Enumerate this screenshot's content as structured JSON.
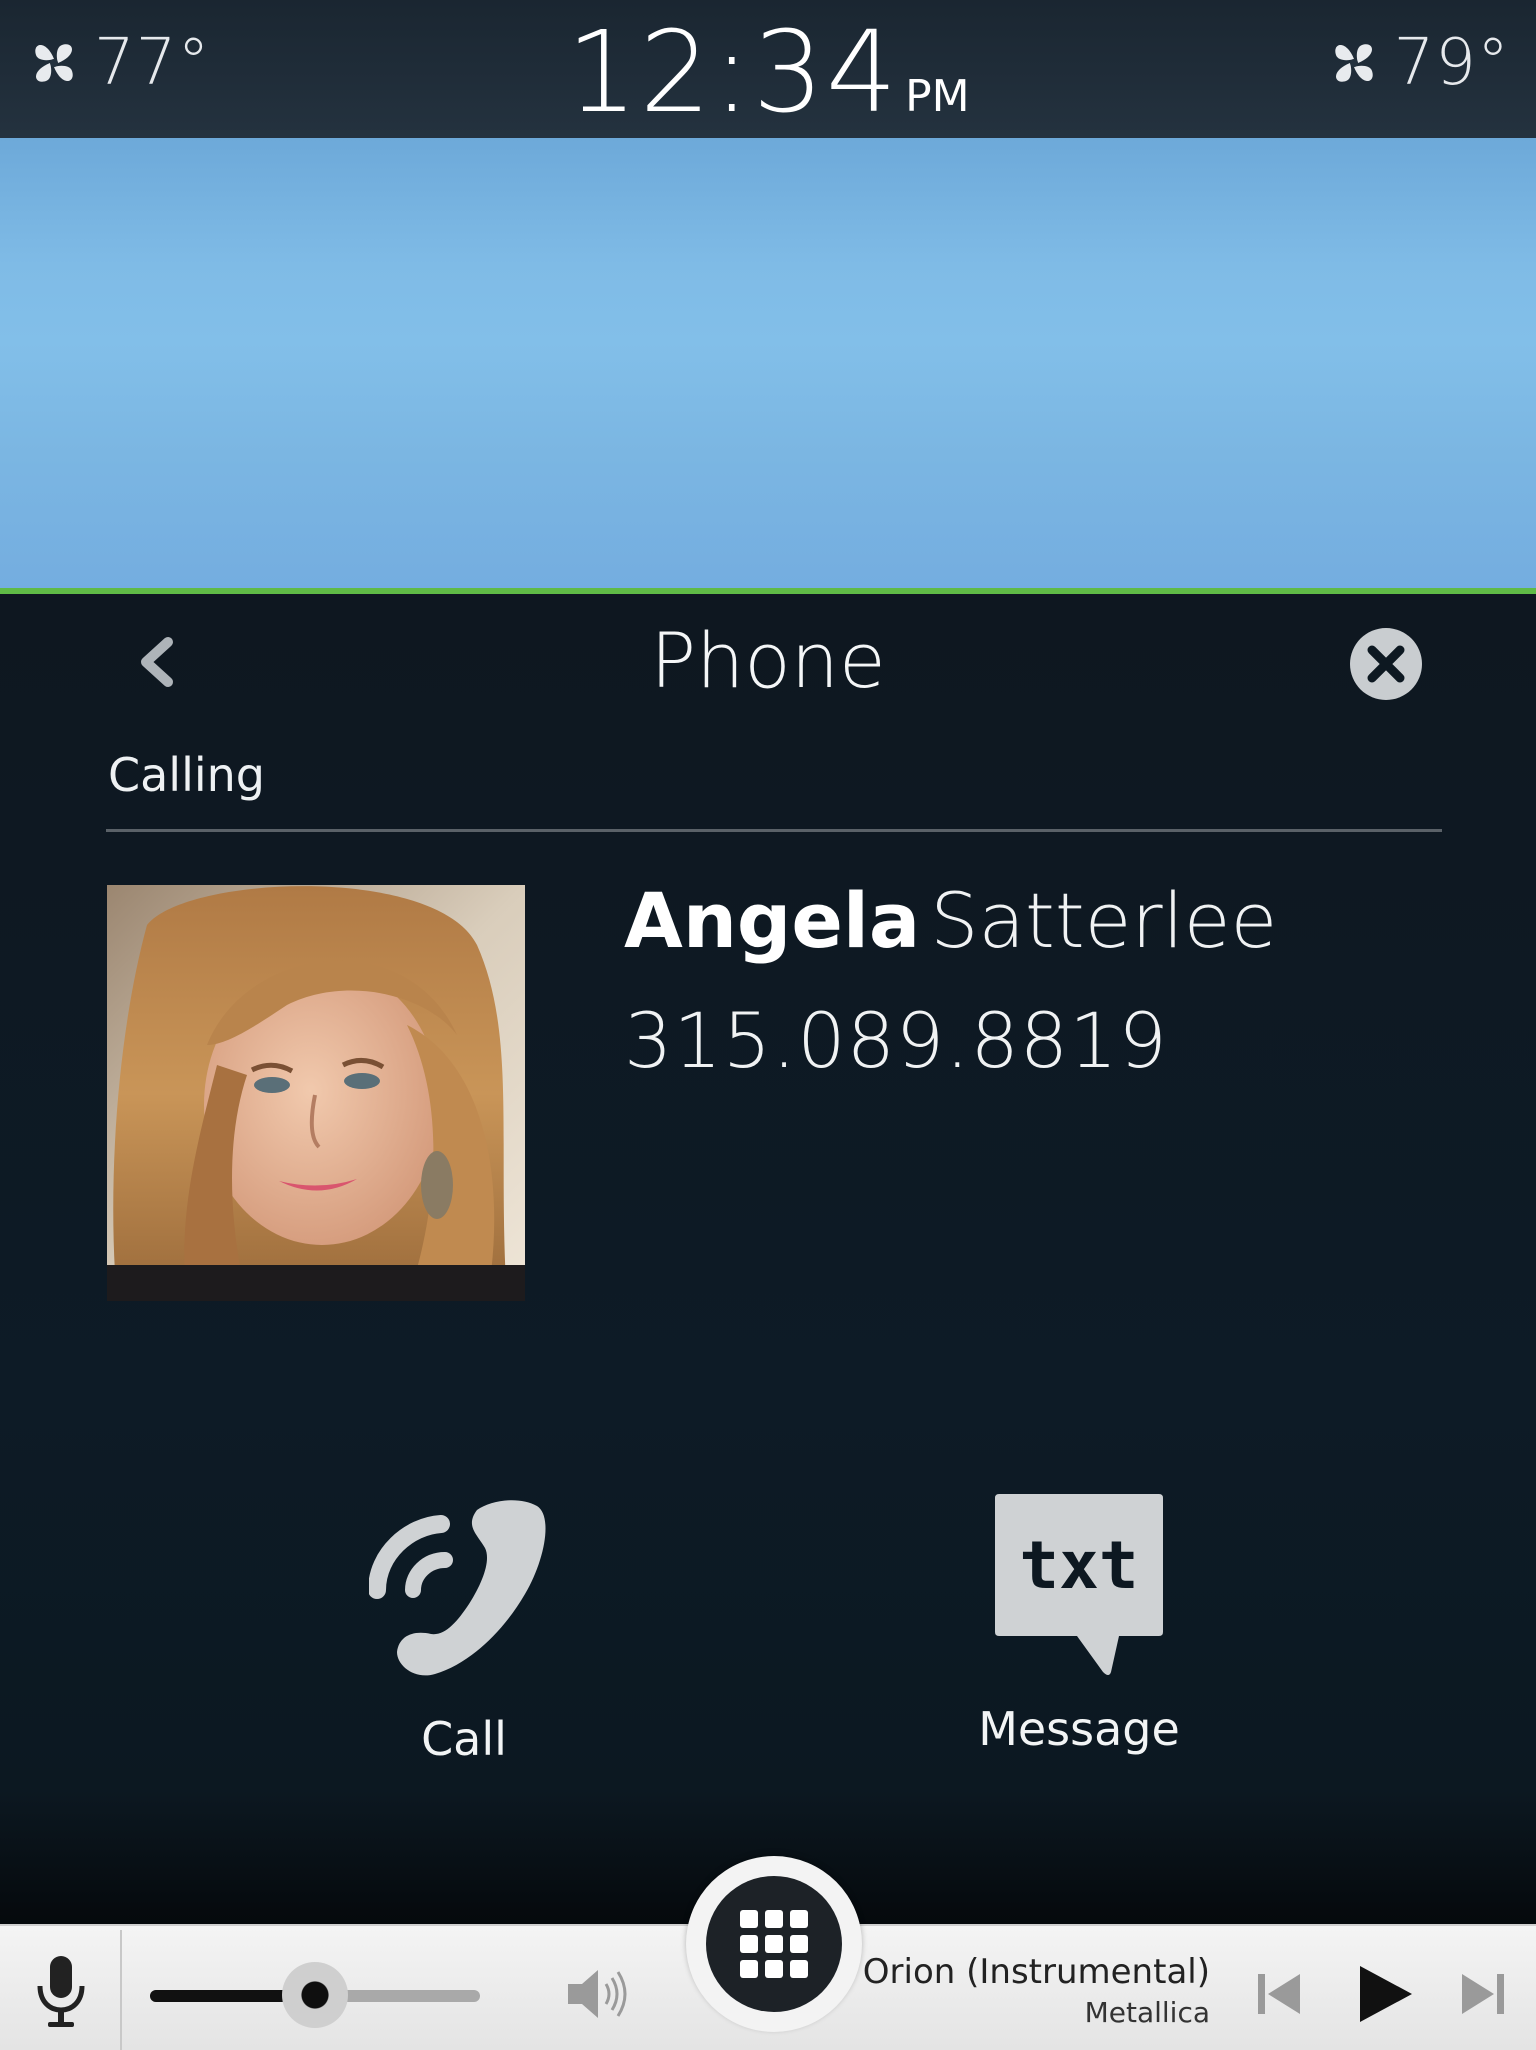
{
  "status_bar": {
    "temp_left": "77°",
    "temp_right": "79°",
    "time": "12:34",
    "ampm": "PM",
    "fan_icon": "fan-icon"
  },
  "accent_color": "#5fba46",
  "phone": {
    "title": "Phone",
    "section_label": "Calling",
    "contact": {
      "first_name": "Angela",
      "last_name": "Satterlee",
      "number": "315.089.8819"
    },
    "actions": {
      "call_label": "Call",
      "message_label": "Message",
      "message_icon_text": "txt"
    }
  },
  "media": {
    "track_title": "Orion (Instrumental)",
    "track_artist": "Metallica",
    "volume_level": 0.5
  }
}
